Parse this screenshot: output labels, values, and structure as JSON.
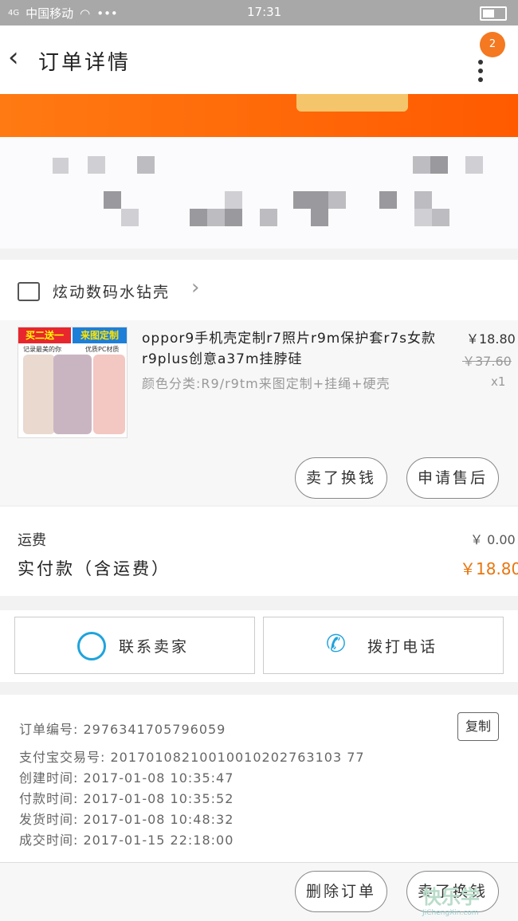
{
  "status_bar": {
    "carrier": "中国移动",
    "time": "17:31",
    "dots": "•••",
    "net": "4G"
  },
  "header": {
    "title": "订单详情",
    "badge_count": "2"
  },
  "shop": {
    "name": "炫动数码水钻壳"
  },
  "product": {
    "name": "oppor9手机壳定制r7照片r9m保护套r7s女款r9plus创意a37m挂脖硅",
    "sku": "颜色分类:R9/r9tm来图定制+挂绳+硬壳",
    "price": "￥18.80",
    "original_price": "￥37.60",
    "quantity": "x1",
    "thumb_banner_left": "买二送一",
    "thumb_banner_right": "来图定制",
    "thumb_sub_left": "记录最美的你",
    "thumb_sub_right": "优质PC材质"
  },
  "actions": {
    "buy_again": "卖了换钱",
    "after_sale": "申请售后"
  },
  "totals": {
    "shipping_label": "运费",
    "shipping_value": "￥ 0.00",
    "paid_label": "实付款（含运费）",
    "paid_value": "￥18.80"
  },
  "contact": {
    "seller": "联系卖家",
    "call": "拨打电话"
  },
  "order_info": {
    "order_no": "订单编号: 2976341705796059",
    "alipay_no": "支付宝交易号: 20170108210010010202763103 77",
    "created": "创建时间: 2017-01-08  10:35:47",
    "paid": "付款时间: 2017-01-08  10:35:52",
    "shipped": "发货时间: 2017-01-08  10:48:32",
    "completed": "成交时间: 2017-01-15  22:18:00",
    "copy_label": "复制"
  },
  "bottom": {
    "delete_order": "删除订单",
    "sell_again": "卖了换钱"
  },
  "watermark": {
    "brand": "快乐学",
    "url": "JiChengXin.com"
  },
  "colors": {
    "accent": "#f47920",
    "icon_blue": "#1fa3dc",
    "price_orange": "#e8760e"
  }
}
